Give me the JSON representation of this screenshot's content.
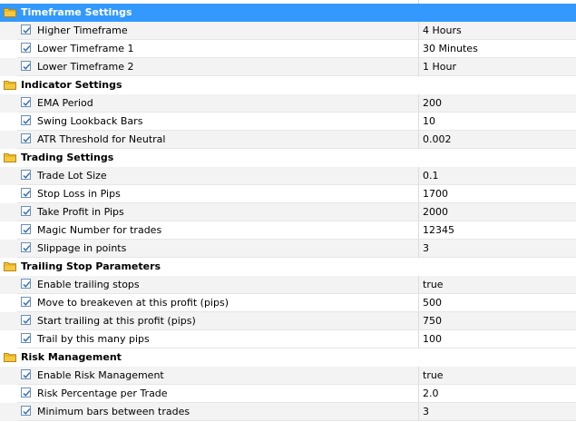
{
  "groups": [
    {
      "title": "Timeframe Settings",
      "selected": true,
      "params": [
        {
          "label": "Higher Timeframe",
          "value": "4 Hours"
        },
        {
          "label": "Lower Timeframe 1",
          "value": "30 Minutes"
        },
        {
          "label": "Lower Timeframe 2",
          "value": "1 Hour"
        }
      ]
    },
    {
      "title": "Indicator Settings",
      "selected": false,
      "params": [
        {
          "label": "EMA Period",
          "value": "200"
        },
        {
          "label": "Swing Lookback Bars",
          "value": "10"
        },
        {
          "label": "ATR Threshold for Neutral",
          "value": "0.002"
        }
      ]
    },
    {
      "title": "Trading Settings",
      "selected": false,
      "params": [
        {
          "label": "Trade Lot Size",
          "value": "0.1"
        },
        {
          "label": "Stop Loss in Pips",
          "value": "1700"
        },
        {
          "label": "Take Profit in Pips",
          "value": "2000"
        },
        {
          "label": "Magic Number for trades",
          "value": "12345"
        },
        {
          "label": "Slippage in points",
          "value": "3"
        }
      ]
    },
    {
      "title": "Trailing Stop Parameters",
      "selected": false,
      "params": [
        {
          "label": "Enable trailing stops",
          "value": "true"
        },
        {
          "label": "Move to breakeven at this profit (pips)",
          "value": "500"
        },
        {
          "label": "Start trailing at this profit (pips)",
          "value": "750"
        },
        {
          "label": "Trail by this many pips",
          "value": "100"
        }
      ]
    },
    {
      "title": "Risk Management",
      "selected": false,
      "params": [
        {
          "label": "Enable Risk Management",
          "value": "true"
        },
        {
          "label": "Risk Percentage per Trade",
          "value": "2.0"
        },
        {
          "label": "Minimum bars between trades",
          "value": "3"
        }
      ]
    }
  ],
  "icons": {
    "group": "folder-icon",
    "param": "checkbox-checked-icon"
  },
  "colors": {
    "selection": "#3399ff",
    "alt_row": "#f3f3f3",
    "folder": "#f5c842",
    "check": "#2f6db5"
  }
}
